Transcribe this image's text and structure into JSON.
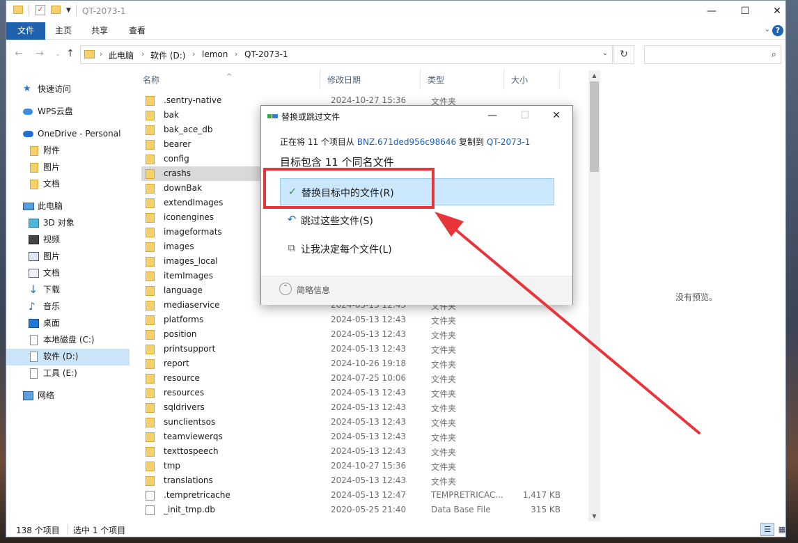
{
  "window": {
    "title": "QT-2073-1",
    "controls": {
      "minimize": "—",
      "maximize": "☐",
      "close": "✕"
    }
  },
  "ribbon": {
    "tabs": [
      "文件",
      "主页",
      "共享",
      "查看"
    ],
    "help": "?",
    "accent": "#1e62b0"
  },
  "address": {
    "crumbs": [
      "此电脑",
      "软件 (D:)",
      "lemon",
      "QT-2073-1"
    ],
    "search_placeholder": ""
  },
  "navpane": {
    "items": [
      {
        "label": "快速访问",
        "icon": "star-pin-icon"
      },
      {
        "label": "WPS云盘",
        "icon": "cloud-icon"
      },
      {
        "label": "OneDrive - Personal",
        "icon": "onedrive-icon"
      },
      {
        "label": "附件",
        "icon": "folder-icon"
      },
      {
        "label": "图片",
        "icon": "folder-icon"
      },
      {
        "label": "文档",
        "icon": "folder-icon"
      },
      {
        "label": "此电脑",
        "icon": "computer-icon"
      },
      {
        "label": "3D 对象",
        "icon": "cube-icon"
      },
      {
        "label": "视频",
        "icon": "film-icon"
      },
      {
        "label": "图片",
        "icon": "picture-icon"
      },
      {
        "label": "文档",
        "icon": "document-icon"
      },
      {
        "label": "下载",
        "icon": "download-icon"
      },
      {
        "label": "音乐",
        "icon": "music-icon"
      },
      {
        "label": "桌面",
        "icon": "desktop-icon"
      },
      {
        "label": "本地磁盘 (C:)",
        "icon": "drive-icon"
      },
      {
        "label": "软件 (D:)",
        "icon": "drive-icon"
      },
      {
        "label": "工具 (E:)",
        "icon": "drive-icon"
      },
      {
        "label": "网络",
        "icon": "network-icon"
      }
    ]
  },
  "columns": {
    "name": "名称",
    "date": "修改日期",
    "type": "类型",
    "size": "大小"
  },
  "files": [
    {
      "name": ".sentry-native",
      "date": "2024-10-27 15:36",
      "type": "文件夹",
      "size": ""
    },
    {
      "name": "bak",
      "date": "",
      "type": "",
      "size": ""
    },
    {
      "name": "bak_ace_db",
      "date": "",
      "type": "",
      "size": ""
    },
    {
      "name": "bearer",
      "date": "",
      "type": "",
      "size": ""
    },
    {
      "name": "config",
      "date": "",
      "type": "",
      "size": ""
    },
    {
      "name": "crashs",
      "date": "",
      "type": "",
      "size": ""
    },
    {
      "name": "downBak",
      "date": "",
      "type": "",
      "size": ""
    },
    {
      "name": "extendImages",
      "date": "",
      "type": "",
      "size": ""
    },
    {
      "name": "iconengines",
      "date": "",
      "type": "",
      "size": ""
    },
    {
      "name": "imageformats",
      "date": "",
      "type": "",
      "size": ""
    },
    {
      "name": "images",
      "date": "",
      "type": "",
      "size": ""
    },
    {
      "name": "images_local",
      "date": "",
      "type": "",
      "size": ""
    },
    {
      "name": "itemImages",
      "date": "",
      "type": "",
      "size": ""
    },
    {
      "name": "language",
      "date": "",
      "type": "",
      "size": ""
    },
    {
      "name": "mediaservice",
      "date": "2024-05-13 12:43",
      "type": "文件夹",
      "size": ""
    },
    {
      "name": "platforms",
      "date": "2024-05-13 12:43",
      "type": "文件夹",
      "size": ""
    },
    {
      "name": "position",
      "date": "2024-05-13 12:43",
      "type": "文件夹",
      "size": ""
    },
    {
      "name": "printsupport",
      "date": "2024-05-13 12:43",
      "type": "文件夹",
      "size": ""
    },
    {
      "name": "report",
      "date": "2024-10-26 19:18",
      "type": "文件夹",
      "size": ""
    },
    {
      "name": "resource",
      "date": "2024-07-25 10:06",
      "type": "文件夹",
      "size": ""
    },
    {
      "name": "resources",
      "date": "2024-05-13 12:43",
      "type": "文件夹",
      "size": ""
    },
    {
      "name": "sqldrivers",
      "date": "2024-05-13 12:43",
      "type": "文件夹",
      "size": ""
    },
    {
      "name": "sunclientsos",
      "date": "2024-05-13 12:43",
      "type": "文件夹",
      "size": ""
    },
    {
      "name": "teamviewerqs",
      "date": "2024-05-13 12:43",
      "type": "文件夹",
      "size": ""
    },
    {
      "name": "texttospeech",
      "date": "2024-05-13 12:43",
      "type": "文件夹",
      "size": ""
    },
    {
      "name": "tmp",
      "date": "2024-10-27 15:36",
      "type": "文件夹",
      "size": ""
    },
    {
      "name": "translations",
      "date": "2024-05-13 12:43",
      "type": "文件夹",
      "size": ""
    },
    {
      "name": ".tempretricache",
      "date": "2024-05-13 12:47",
      "type": "TEMPRETRICAC...",
      "size": "1,417 KB"
    },
    {
      "name": "_init_tmp.db",
      "date": "2020-05-25 21:40",
      "type": "Data Base File",
      "size": "315 KB"
    }
  ],
  "preview": {
    "empty_text": "没有预览。"
  },
  "status": {
    "count": "138 个项目",
    "selected": "选中 1 个项目"
  },
  "dialog": {
    "title": "替换或跳过文件",
    "info_prefix": "正在将 11 个项目从",
    "source": "BNZ.671ded956c98646",
    "info_mid": "复制到",
    "dest": "QT-2073-1",
    "heading": "目标包含 11 个同名文件",
    "options": [
      {
        "label": "替换目标中的文件(R)",
        "icon": "checkmark-icon",
        "highlighted": true
      },
      {
        "label": "跳过这些文件(S)",
        "icon": "skip-icon",
        "highlighted": false
      },
      {
        "label": "让我决定每个文件(L)",
        "icon": "compare-files-icon",
        "highlighted": false
      }
    ],
    "more_label": "简略信息"
  },
  "annotation": {
    "color": "#e9343a"
  }
}
